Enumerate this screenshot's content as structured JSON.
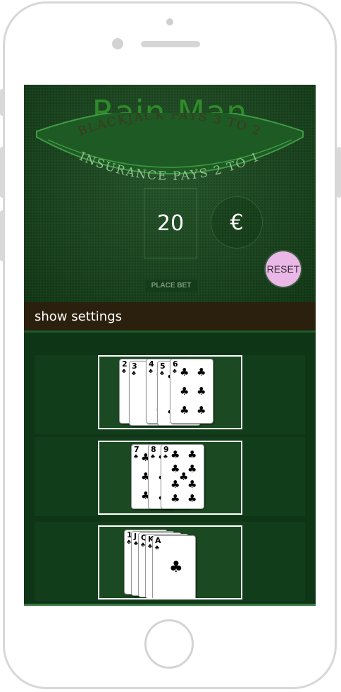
{
  "casino": {
    "name": "Rain Man"
  },
  "table": {
    "arc_top_text": "BLACKJACK PAYS 3 TO 2",
    "arc_bottom_text": "INSURANCE PAYS 2 TO 1"
  },
  "bet": {
    "amount": "20",
    "currency": "€"
  },
  "buttons": {
    "reset": "RESET",
    "place_bet": "PLACE BET"
  },
  "settings": {
    "label": "show settings"
  },
  "colors": {
    "felt": "#1b4d20",
    "name_green": "#2f8a2a",
    "reset_pink": "#e9b8e6",
    "settings_bar": "#2b1f0d"
  },
  "hands": [
    {
      "cards": [
        {
          "rank": "2",
          "suit": "♣"
        },
        {
          "rank": "3",
          "suit": "♣"
        },
        {
          "rank": "4",
          "suit": "♣"
        },
        {
          "rank": "5",
          "suit": "♣"
        },
        {
          "rank": "6",
          "suit": "♣"
        }
      ]
    },
    {
      "cards": [
        {
          "rank": "7",
          "suit": "♣"
        },
        {
          "rank": "8",
          "suit": "♣"
        },
        {
          "rank": "9",
          "suit": "♣"
        }
      ]
    },
    {
      "cards": [
        {
          "rank": "10",
          "suit": "♣"
        },
        {
          "rank": "J",
          "suit": "♣"
        },
        {
          "rank": "Q",
          "suit": "♣"
        },
        {
          "rank": "K",
          "suit": "♣"
        },
        {
          "rank": "A",
          "suit": "♣"
        }
      ]
    }
  ]
}
